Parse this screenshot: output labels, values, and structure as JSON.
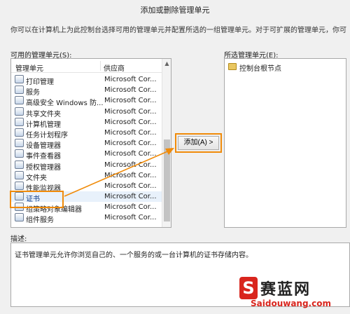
{
  "window": {
    "title": "添加或删除管理单元"
  },
  "intro": "你可以在计算机上为此控制台选择可用的管理单元并配置所选的一组管理单元。对于可扩展的管理单元，你可",
  "available": {
    "label": "可用的管理单元(S):",
    "columns": [
      "管理单元",
      "供应商"
    ],
    "rows": [
      {
        "name": "打印管理",
        "vendor": "Microsoft Cor...",
        "icon": "printer-icon"
      },
      {
        "name": "服务",
        "vendor": "Microsoft Cor...",
        "icon": "gear-icon"
      },
      {
        "name": "高级安全 Windows 防...",
        "vendor": "Microsoft Cor...",
        "icon": "firewall-icon"
      },
      {
        "name": "共享文件夹",
        "vendor": "Microsoft Cor...",
        "icon": "shared-folder-icon"
      },
      {
        "name": "计算机管理",
        "vendor": "Microsoft Cor...",
        "icon": "computer-icon"
      },
      {
        "name": "任务计划程序",
        "vendor": "Microsoft Cor...",
        "icon": "scheduler-icon"
      },
      {
        "name": "设备管理器",
        "vendor": "Microsoft Cor...",
        "icon": "device-icon"
      },
      {
        "name": "事件查看器",
        "vendor": "Microsoft Cor...",
        "icon": "event-icon"
      },
      {
        "name": "授权管理器",
        "vendor": "Microsoft Cor...",
        "icon": "authorization-icon"
      },
      {
        "name": "文件夹",
        "vendor": "Microsoft Cor...",
        "icon": "folder-icon"
      },
      {
        "name": "性能监视器",
        "vendor": "Microsoft Cor...",
        "icon": "performance-icon"
      },
      {
        "name": "证书",
        "vendor": "Microsoft Cor...",
        "icon": "certificate-icon"
      },
      {
        "name": "组策略对象编辑器",
        "vendor": "Microsoft Cor...",
        "icon": "policy-icon"
      },
      {
        "name": "组件服务",
        "vendor": "Microsoft Cor...",
        "icon": "component-icon"
      }
    ]
  },
  "add_button": {
    "label": "添加(A) >"
  },
  "selected": {
    "label": "所选管理单元(E):",
    "items": [
      {
        "name": "控制台根节点",
        "icon": "folder-icon"
      }
    ]
  },
  "description": {
    "label": "描述:",
    "text": "证书管理单元允许你浏览自己的、一个服务的或一台计算机的证书存储内容。"
  },
  "watermark": {
    "badge": "S",
    "cn": "赛蓝网",
    "en": "Saidouwang.com"
  },
  "colors": {
    "highlight": "#f08b0a",
    "watermark_red": "#d9251d"
  }
}
